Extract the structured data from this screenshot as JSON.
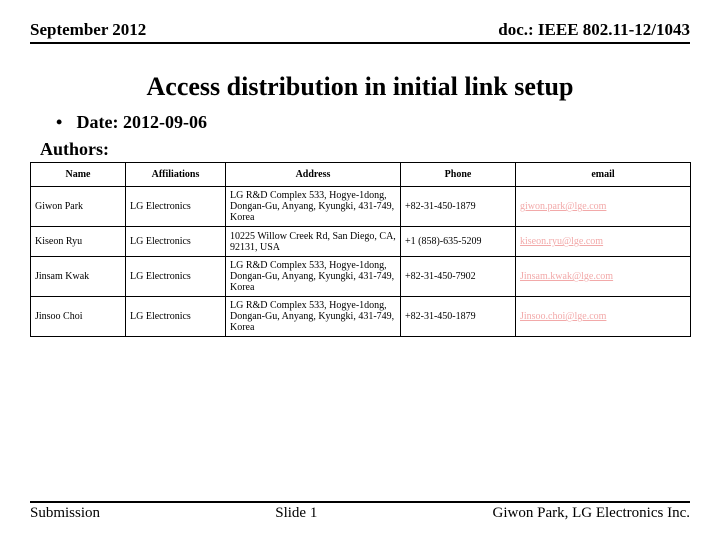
{
  "header": {
    "left": "September 2012",
    "right": "doc.: IEEE 802.11-12/1043"
  },
  "title": "Access distribution in initial link setup",
  "date_prefix": "Date: ",
  "date_value": "2012-09-06",
  "authors_label": "Authors:",
  "table": {
    "headers": [
      "Name",
      "Affiliations",
      "Address",
      "Phone",
      "email"
    ],
    "rows": [
      {
        "name": "Giwon Park",
        "affiliation": "LG Electronics",
        "address": "LG R&D Complex 533, Hogye-1dong, Dongan-Gu, Anyang, Kyungki, 431-749, Korea",
        "phone": "+82-31-450-1879",
        "email": "giwon.park@lge.com"
      },
      {
        "name": " Kiseon Ryu",
        "affiliation": " LG Electronics",
        "address": " 10225 Willow Creek Rd, San Diego, CA, 92131, USA",
        "phone": " +1 (858)-635-5209",
        "email": " kiseon.ryu@lge.com"
      },
      {
        "name": "Jinsam Kwak",
        "affiliation": "LG Electronics",
        "address": "LG R&D Complex 533, Hogye-1dong, Dongan-Gu, Anyang, Kyungki, 431-749, Korea",
        "phone": "+82-31-450-7902",
        "email": "Jinsam.kwak@lge.com"
      },
      {
        "name": "Jinsoo Choi",
        "affiliation": "LG Electronics",
        "address": "LG R&D Complex 533, Hogye-1dong, Dongan-Gu, Anyang, Kyungki, 431-749, Korea",
        "phone": "+82-31-450-1879",
        "email": "Jinsoo.choi@lge.com"
      }
    ]
  },
  "footer": {
    "left": "Submission",
    "center": "Slide 1",
    "right": "Giwon Park, LG Electronics Inc."
  }
}
